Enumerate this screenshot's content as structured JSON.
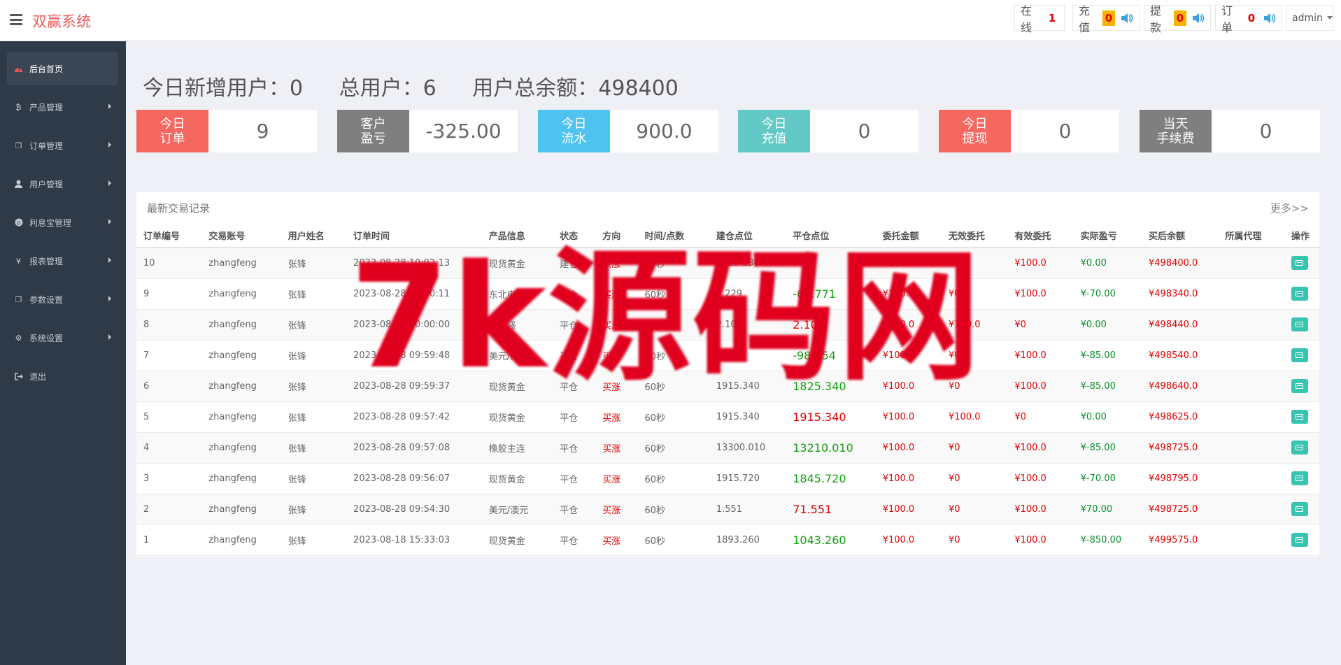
{
  "app": {
    "brand": "双赢系统"
  },
  "topbar": {
    "online_label": "在线",
    "online_count": "1",
    "recharge_label": "充值",
    "recharge_count": "0",
    "withdraw_label": "提款",
    "withdraw_count": "0",
    "order_label": "订单",
    "order_count": "0",
    "user": "admin"
  },
  "sidebar": {
    "items": [
      {
        "label": "后台首页",
        "icon": "dashboard-icon"
      },
      {
        "label": "产品管理",
        "icon": "bitcoin-icon"
      },
      {
        "label": "订单管理",
        "icon": "copy-icon"
      },
      {
        "label": "用户管理",
        "icon": "user-icon"
      },
      {
        "label": "利息宝管理",
        "icon": "pinterest-icon"
      },
      {
        "label": "报表管理",
        "icon": "yen-icon"
      },
      {
        "label": "参数设置",
        "icon": "copy-icon"
      },
      {
        "label": "系统设置",
        "icon": "gears-icon"
      },
      {
        "label": "退出",
        "icon": "sign-out-icon"
      }
    ]
  },
  "stats": {
    "new_users_label": "今日新增用户：",
    "new_users": "0",
    "total_users_label": "总用户：",
    "total_users": "6",
    "balance_label": "用户总余额：",
    "balance": "498400"
  },
  "cards": [
    {
      "line1": "今日",
      "line2": "订单",
      "value": "9",
      "color": "#f5685f"
    },
    {
      "line1": "客户",
      "line2": "盈亏",
      "value": "-325.00",
      "color": "#7f7f7f"
    },
    {
      "line1": "今日",
      "line2": "流水",
      "value": "900.0",
      "color": "#4fc3f0"
    },
    {
      "line1": "今日",
      "line2": "充值",
      "value": "0",
      "color": "#62c9c6"
    },
    {
      "line1": "今日",
      "line2": "提现",
      "value": "0",
      "color": "#f5685f"
    },
    {
      "line1": "当天",
      "line2": "手续费",
      "value": "0",
      "color": "#7f7f7f"
    }
  ],
  "panel": {
    "title": "最新交易记录",
    "more": "更多>>"
  },
  "table": {
    "headers": [
      "订单编号",
      "交易账号",
      "用户姓名",
      "订单时间",
      "产品信息",
      "状态",
      "方向",
      "时间/点数",
      "建仓点位",
      "平仓点位",
      "委托金额",
      "无效委托",
      "有效委托",
      "实际盈亏",
      "买后余额",
      "所属代理",
      "操作"
    ],
    "rows": [
      {
        "id": "10",
        "account": "zhangfeng",
        "name": "张锋",
        "time": "2023-08-28 10:02:13",
        "product": "现货黄金",
        "status": "建仓",
        "dir": "买涨",
        "period": "60秒",
        "open": "1915.330",
        "close": "",
        "close_color": "red",
        "amount": "¥100.0",
        "invalid": "¥0",
        "valid": "¥100.0",
        "pnl": "¥0.00",
        "balance": "¥498400.0"
      },
      {
        "id": "9",
        "account": "zhangfeng",
        "name": "张锋",
        "time": "2023-08-28 10:00:11",
        "product": "东北电气",
        "status": "平仓",
        "dir": "买涨",
        "period": "60秒",
        "open": "2.229",
        "close": "-69.771",
        "close_color": "green",
        "amount": "¥100.0",
        "invalid": "¥0",
        "valid": "¥100.0",
        "pnl": "¥-70.00",
        "balance": "¥498340.0"
      },
      {
        "id": "8",
        "account": "zhangfeng",
        "name": "张锋",
        "time": "2023-08-28 10:00:00",
        "product": "华鑫盛",
        "status": "平仓",
        "dir": "买涨",
        "period": "60秒",
        "open": "2.100",
        "close": "2.100",
        "close_color": "red",
        "amount": "¥100.0",
        "invalid": "¥100.0",
        "valid": "¥0",
        "pnl": "¥0.00",
        "balance": "¥498440.0"
      },
      {
        "id": "7",
        "account": "zhangfeng",
        "name": "张锋",
        "time": "2023-08-28 09:59:48",
        "product": "美元/澳元",
        "status": "平仓",
        "dir": "买涨",
        "period": "60秒",
        "open": "1.546",
        "close": "-98.454",
        "close_color": "green",
        "amount": "¥100.0",
        "invalid": "¥0",
        "valid": "¥100.0",
        "pnl": "¥-85.00",
        "balance": "¥498540.0"
      },
      {
        "id": "6",
        "account": "zhangfeng",
        "name": "张锋",
        "time": "2023-08-28 09:59:37",
        "product": "现货黄金",
        "status": "平仓",
        "dir": "买涨",
        "period": "60秒",
        "open": "1915.340",
        "close": "1825.340",
        "close_color": "green",
        "amount": "¥100.0",
        "invalid": "¥0",
        "valid": "¥100.0",
        "pnl": "¥-85.00",
        "balance": "¥498640.0"
      },
      {
        "id": "5",
        "account": "zhangfeng",
        "name": "张锋",
        "time": "2023-08-28 09:57:42",
        "product": "现货黄金",
        "status": "平仓",
        "dir": "买涨",
        "period": "60秒",
        "open": "1915.340",
        "close": "1915.340",
        "close_color": "red",
        "amount": "¥100.0",
        "invalid": "¥100.0",
        "valid": "¥0",
        "pnl": "¥0.00",
        "balance": "¥498625.0"
      },
      {
        "id": "4",
        "account": "zhangfeng",
        "name": "张锋",
        "time": "2023-08-28 09:57:08",
        "product": "橡胶主连",
        "status": "平仓",
        "dir": "买涨",
        "period": "60秒",
        "open": "13300.010",
        "close": "13210.010",
        "close_color": "green",
        "amount": "¥100.0",
        "invalid": "¥0",
        "valid": "¥100.0",
        "pnl": "¥-85.00",
        "balance": "¥498725.0"
      },
      {
        "id": "3",
        "account": "zhangfeng",
        "name": "张锋",
        "time": "2023-08-28 09:56:07",
        "product": "现货黄金",
        "status": "平仓",
        "dir": "买涨",
        "period": "60秒",
        "open": "1915.720",
        "close": "1845.720",
        "close_color": "green",
        "amount": "¥100.0",
        "invalid": "¥0",
        "valid": "¥100.0",
        "pnl": "¥-70.00",
        "balance": "¥498795.0"
      },
      {
        "id": "2",
        "account": "zhangfeng",
        "name": "张锋",
        "time": "2023-08-28 09:54:30",
        "product": "美元/澳元",
        "status": "平仓",
        "dir": "买涨",
        "period": "60秒",
        "open": "1.551",
        "close": "71.551",
        "close_color": "red",
        "amount": "¥100.0",
        "invalid": "¥0",
        "valid": "¥100.0",
        "pnl": "¥70.00",
        "balance": "¥498725.0"
      },
      {
        "id": "1",
        "account": "zhangfeng",
        "name": "张锋",
        "time": "2023-08-18 15:33:03",
        "product": "现货黄金",
        "status": "平仓",
        "dir": "买涨",
        "period": "60秒",
        "open": "1893.260",
        "close": "1043.260",
        "close_color": "green",
        "amount": "¥100.0",
        "invalid": "¥0",
        "valid": "¥100.0",
        "pnl": "¥-850.00",
        "balance": "¥499575.0"
      }
    ]
  },
  "watermark": "7k源码网"
}
